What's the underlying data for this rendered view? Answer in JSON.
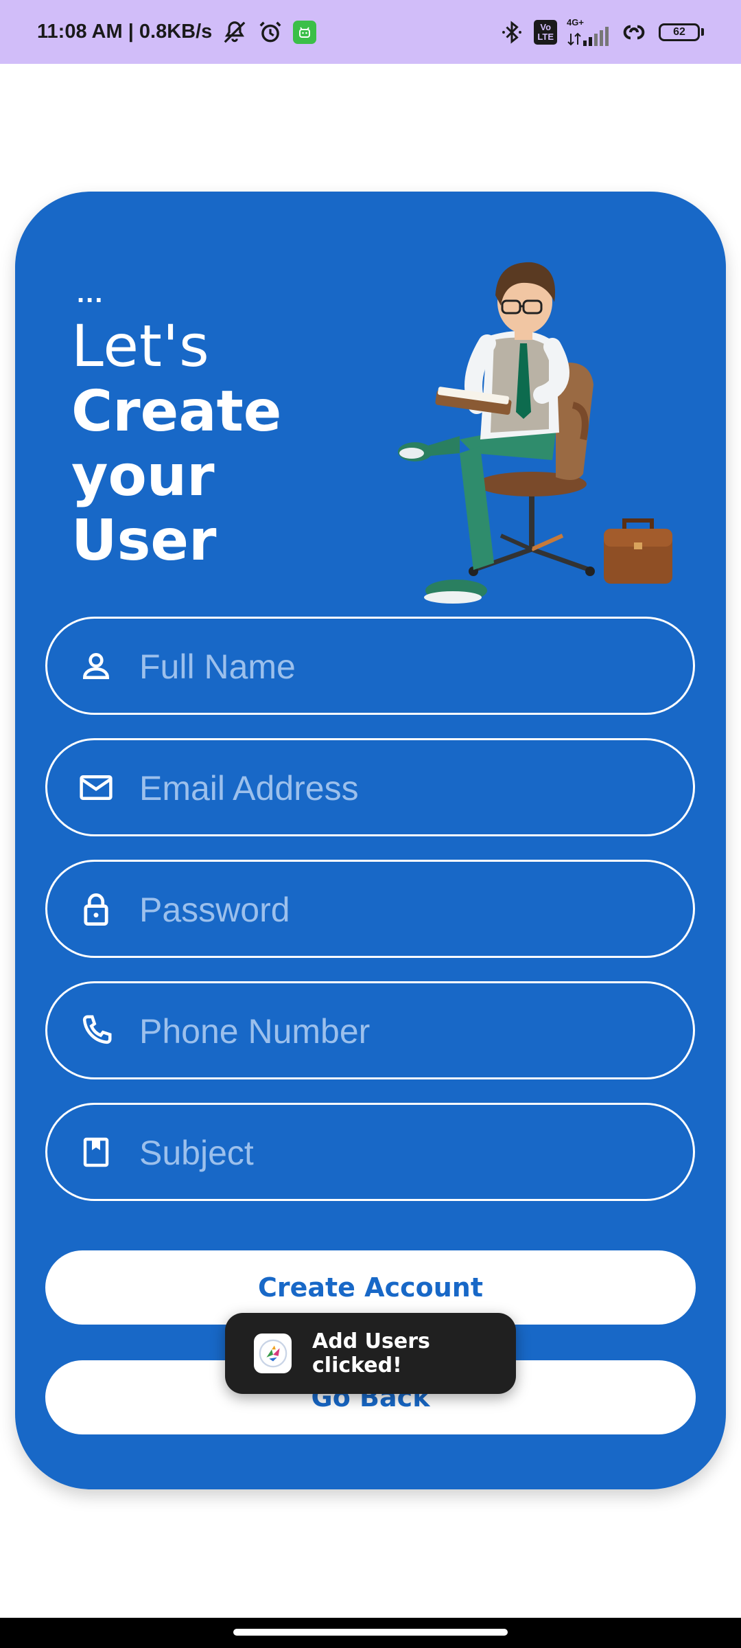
{
  "status_bar": {
    "time_speed": "11:08 AM | 0.8KB/s",
    "volte": "Vo\nLTE",
    "network": "4G+",
    "battery": "62",
    "icons": [
      "mute-icon",
      "alarm-icon",
      "android-app-icon",
      "bluetooth-icon",
      "volte-icon",
      "signal-icon",
      "hotspot-link-icon",
      "battery-icon"
    ]
  },
  "header": {
    "dots": "...",
    "line1": "Let's",
    "line2": "Create",
    "line3": "your",
    "line4": "User"
  },
  "form": {
    "full_name": {
      "placeholder": "Full Name",
      "value": "",
      "icon": "person-icon"
    },
    "email": {
      "placeholder": "Email Address",
      "value": "",
      "icon": "mail-icon"
    },
    "password": {
      "placeholder": "Password",
      "value": "",
      "icon": "lock-icon"
    },
    "phone": {
      "placeholder": "Phone Number",
      "value": "",
      "icon": "phone-icon"
    },
    "subject": {
      "placeholder": "Subject",
      "value": "",
      "icon": "bookmark-icon"
    }
  },
  "buttons": {
    "create_account": "Create Account",
    "go_back": "Go Back"
  },
  "toast": {
    "message": "Add Users clicked!"
  },
  "colors": {
    "status_bar": "#d1bdf9",
    "card": "#1868c7",
    "button": "#ffffff",
    "toast": "#202020"
  }
}
